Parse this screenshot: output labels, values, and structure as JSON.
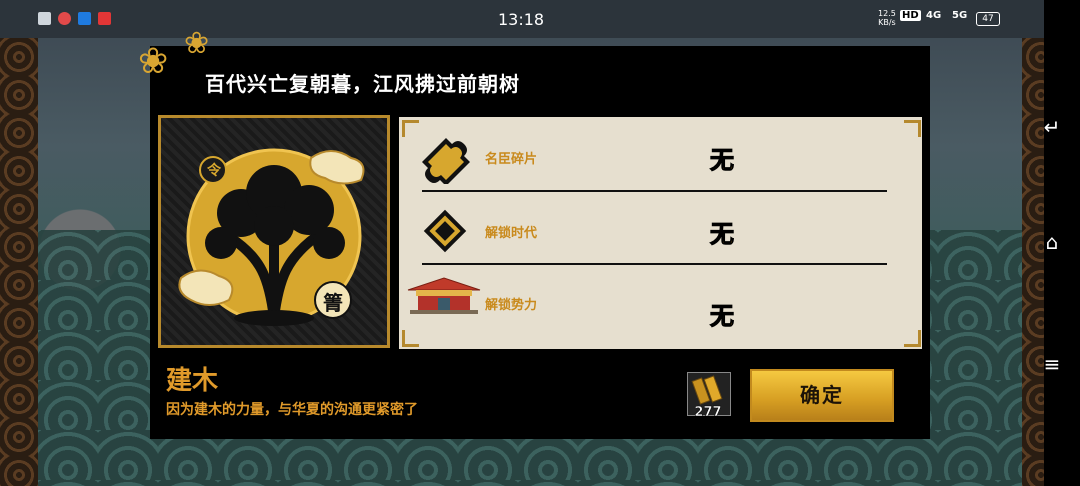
{
  "status_bar": {
    "time": "13:18",
    "net_speed": "12.5",
    "net_unit": "KB/s",
    "hd_badge": "HD",
    "signal_1": "4G",
    "signal_2": "5G",
    "battery": "47",
    "notification_icons": [
      "doc-icon",
      "red-app-icon",
      "zhihu-icon",
      "toutiao-icon"
    ]
  },
  "dialog": {
    "title": "百代兴亡复朝暮，江风拂过前朝树",
    "emblem_glyphs": {
      "top": "令",
      "bottom": "箐"
    },
    "rows": [
      {
        "label": "名臣碎片",
        "value": "无",
        "icon": "puzzle-icon"
      },
      {
        "label": "解锁时代",
        "value": "无",
        "icon": "diamond-token-icon"
      },
      {
        "label": "解锁势力",
        "value": "无",
        "icon": "palace-icon"
      }
    ],
    "name": "建木",
    "description": "因为建木的力量，与华夏的沟通更紧密了",
    "item_count": "277",
    "confirm_label": "确定"
  },
  "colors": {
    "gold": "#d9a632",
    "label_orange": "#e09a2a",
    "panel_bg": "#e6dfcf",
    "dialog_bg": "#000000"
  }
}
